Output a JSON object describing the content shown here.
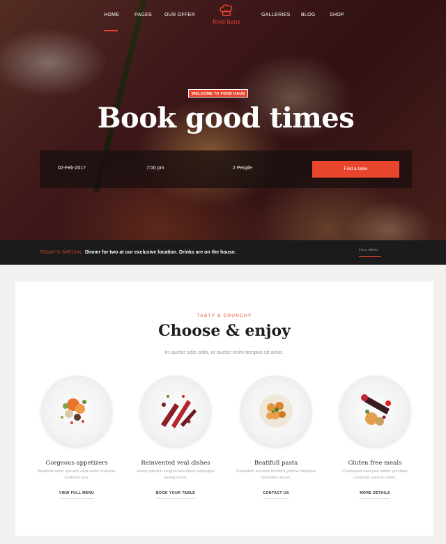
{
  "nav": {
    "items": [
      "HOME",
      "PAGES",
      "OUR OFFER",
      "GALLERIES",
      "BLOG",
      "SHOP"
    ],
    "active": "HOME",
    "logo_text": "food haus",
    "logo_icon": "chef-hat-icon"
  },
  "hero": {
    "badge": "WELCOME TO FOOD HAUS",
    "title": "Book good times"
  },
  "booking": {
    "date": "02-Feb-2017",
    "time": "7:00 pm",
    "people": "2 People",
    "button": "Find a table"
  },
  "special": {
    "label": "TODAY'S SPECIAL",
    "text": "Dinner for two at our exclusive location. Drinks are on the house.",
    "link": "FULL MENU"
  },
  "section": {
    "kicker": "TASTY & CRUNCHY",
    "title": "Choose & enjoy",
    "subtitle": "In auctor odio odio, ut auctor enim tempus sit amet."
  },
  "dishes": [
    {
      "title": "Gorgeous appetizers",
      "desc": "Beetroot water spinach okra water chestnut ricebean pea.",
      "link": "VIEW FULL MENU"
    },
    {
      "title": "Reinvented veal dishes",
      "desc": "Water spinach arugula pea tatsoi aubergine spring onion.",
      "link": "BOOK YOUR TABLE"
    },
    {
      "title": "Beatifull pasta",
      "desc": "Dandelion zucchini burdock yarrow chickpea dandelion sorrel.",
      "link": "CONTACT US"
    },
    {
      "title": "Gluten free meals",
      "desc": "Chickweed okra pea winter purslane coriander yarrow sweet.",
      "link": "MORE DETAILS"
    }
  ],
  "colors": {
    "accent": "#e8452c",
    "dark_bar": "#1b1b1b"
  }
}
